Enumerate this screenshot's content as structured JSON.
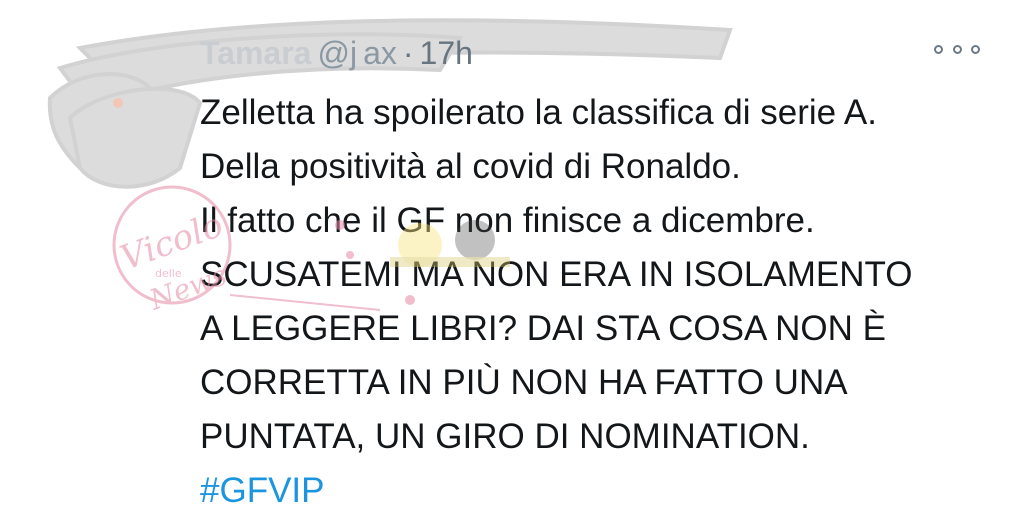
{
  "tweet": {
    "display_name": "Tamara",
    "handle": "@j",
    "handle_tail": "ax",
    "separator": "·",
    "time": "17h",
    "more_icon": "more-options-icon",
    "lines": [
      "Zelletta ha spoilerato la classifica di serie A.",
      "Della positività al covid di Ronaldo.",
      "Il fatto che il GF non finisce a dicembre.",
      "SCUSATEMI MA NON ERA IN ISOLAMENTO",
      "A LEGGERE LIBRI? DAI STA COSA NON È",
      "CORRETTA IN PIÙ NON HA FATTO UNA",
      "PUNTATA, UN GIRO DI NOMINATION."
    ],
    "hashtag": "#GFVIP"
  },
  "watermark": {
    "text_main": "Vicolo",
    "text_small": "delle",
    "text_tail": "News"
  },
  "colors": {
    "text": "#14171a",
    "meta": "#667580",
    "link": "#1b95e0",
    "watermark": "#e48aa6"
  }
}
